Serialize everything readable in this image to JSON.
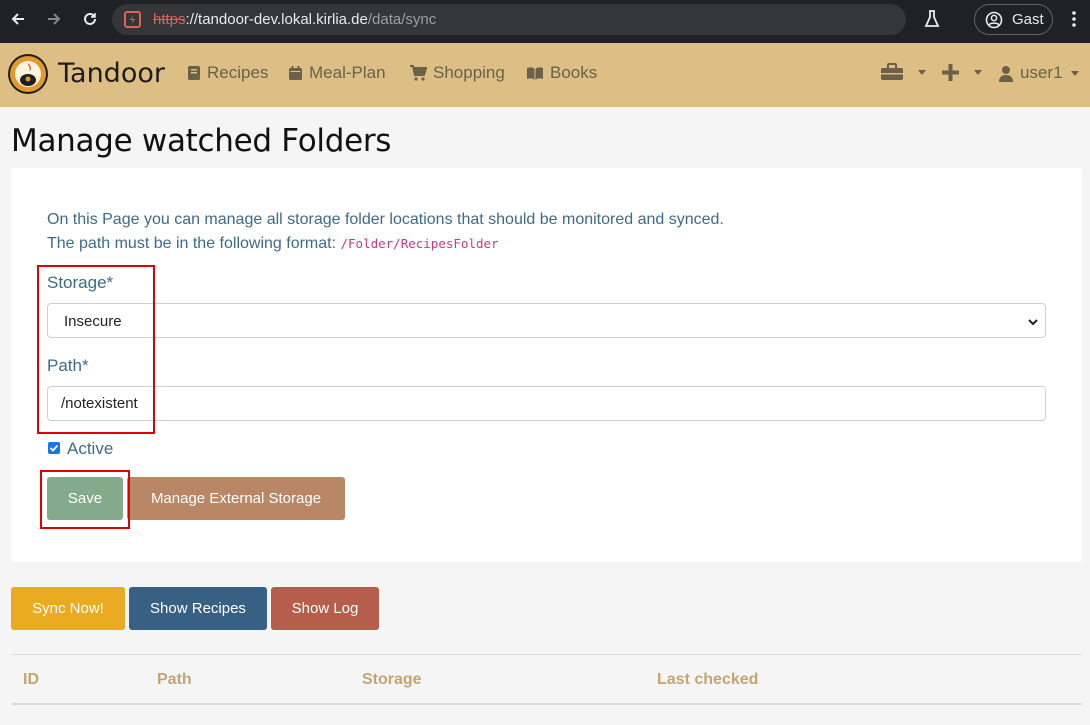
{
  "browser": {
    "url_protocol": "https",
    "url_host": "://tandoor-dev.lokal.kirlia.de",
    "url_path": "/data/sync",
    "profile_label": "Gast",
    "icons": [
      "back-icon",
      "forward-icon",
      "reload-icon",
      "site-info-icon",
      "labs-icon",
      "profile-icon",
      "menu-icon"
    ]
  },
  "navbar": {
    "brand": "Tandoor",
    "items": [
      {
        "label": "Recipes",
        "icon": "book-icon"
      },
      {
        "label": "Meal-Plan",
        "icon": "calendar-icon"
      },
      {
        "label": "Shopping",
        "icon": "cart-icon"
      },
      {
        "label": "Books",
        "icon": "open-book-icon"
      }
    ],
    "user_label": "user1",
    "colors": {
      "background": "#ddbf86",
      "text": "#6b6148"
    }
  },
  "page": {
    "title": "Manage watched Folders",
    "intro_line1": "On this Page you can manage all storage folder locations that should be monitored and synced.",
    "intro_line2": "The path must be in the following format: ",
    "intro_code": "/Folder/RecipesFolder"
  },
  "form": {
    "storage_label": "Storage*",
    "storage_value": "Insecure",
    "path_label": "Path*",
    "path_value": "/notexistent",
    "active_label": "Active",
    "active_checked": true,
    "save_label": "Save",
    "manage_storage_label": "Manage External Storage"
  },
  "actions": {
    "sync_now": "Sync Now!",
    "show_recipes": "Show Recipes",
    "show_log": "Show Log"
  },
  "table": {
    "columns": [
      "ID",
      "Path",
      "Storage",
      "Last checked"
    ]
  },
  "colors": {
    "save": "#82aa8b",
    "manage_storage": "#b98766",
    "sync_now": "#eaaa21",
    "show_recipes": "#385f84",
    "show_log": "#b55e4c",
    "label_text": "#3f6a8a",
    "table_header": "#c4a572",
    "highlight": "#e00000"
  }
}
